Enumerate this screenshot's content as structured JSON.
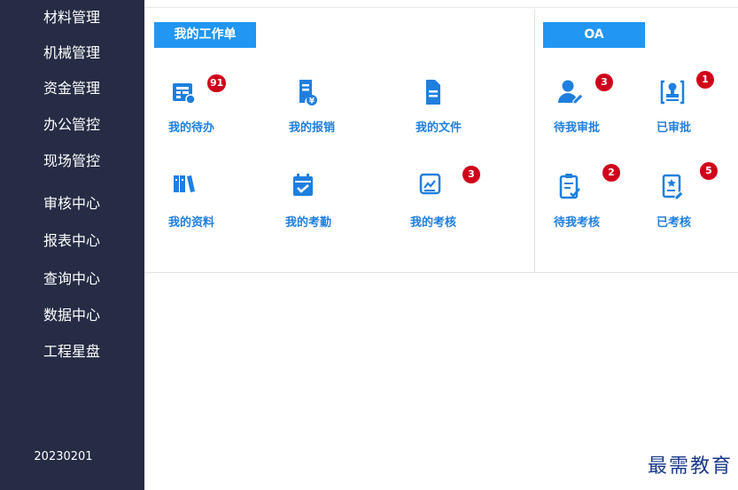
{
  "sidebar": {
    "items": [
      {
        "label": "材料管理"
      },
      {
        "label": "机械管理"
      },
      {
        "label": "资金管理"
      },
      {
        "label": "办公管控"
      },
      {
        "label": "现场管控"
      },
      {
        "label": "审核中心"
      },
      {
        "label": "报表中心"
      },
      {
        "label": "查询中心"
      },
      {
        "label": "数据中心"
      },
      {
        "label": "工程星盘"
      }
    ],
    "version": "20230201"
  },
  "my_worklist": {
    "title": "我的工作单",
    "tiles": [
      {
        "label": "我的待办",
        "icon": "todo-form-icon",
        "badge": "91"
      },
      {
        "label": "我的报销",
        "icon": "reimburse-doc-icon",
        "badge": ""
      },
      {
        "label": "我的文件",
        "icon": "file-icon",
        "badge": ""
      },
      {
        "label": "我的资料",
        "icon": "books-icon",
        "badge": ""
      },
      {
        "label": "我的考勤",
        "icon": "calendar-check-icon",
        "badge": ""
      },
      {
        "label": "我的考核",
        "icon": "chart-board-icon",
        "badge": "3"
      }
    ]
  },
  "oa": {
    "title": "OA",
    "tiles": [
      {
        "label": "待我审批",
        "icon": "user-edit-icon",
        "badge": "3"
      },
      {
        "label": "已审批",
        "icon": "stamp-icon",
        "badge": "1"
      },
      {
        "label": "待我考核",
        "icon": "clipboard-check-icon",
        "badge": "2"
      },
      {
        "label": "已考核",
        "icon": "certificate-icon",
        "badge": "5"
      }
    ]
  },
  "watermark": "最需教育",
  "colors": {
    "sidebar_bg": "#262c44",
    "accent": "#2196f3",
    "tile_text": "#1e7fe0",
    "badge": "#d0021b"
  }
}
